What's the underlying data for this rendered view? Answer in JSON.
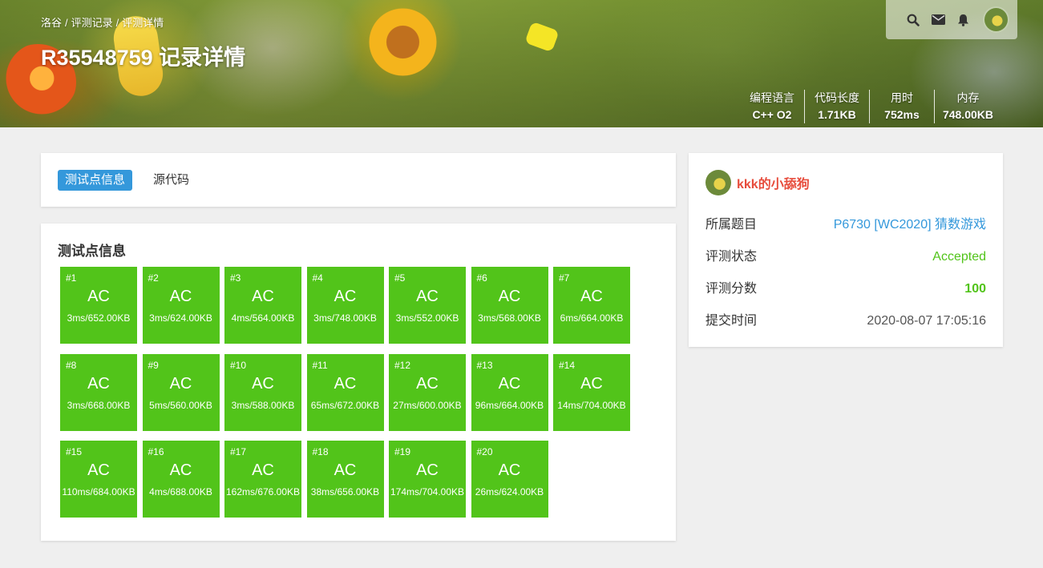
{
  "breadcrumb": {
    "items": [
      "洛谷",
      "评测记录",
      "评测详情"
    ]
  },
  "page": {
    "title": "R35548759 记录详情"
  },
  "stats": [
    {
      "label": "编程语言",
      "value": "C++ O2"
    },
    {
      "label": "代码长度",
      "value": "1.71KB"
    },
    {
      "label": "用时",
      "value": "752ms"
    },
    {
      "label": "内存",
      "value": "748.00KB"
    }
  ],
  "tabs": {
    "testcases_label": "测试点信息",
    "source_label": "源代码"
  },
  "tests_section": {
    "heading": "测试点信息",
    "status_color": "#52c41a",
    "items": [
      {
        "id": "#1",
        "status": "AC",
        "detail": "3ms/652.00KB"
      },
      {
        "id": "#2",
        "status": "AC",
        "detail": "3ms/624.00KB"
      },
      {
        "id": "#3",
        "status": "AC",
        "detail": "4ms/564.00KB"
      },
      {
        "id": "#4",
        "status": "AC",
        "detail": "3ms/748.00KB"
      },
      {
        "id": "#5",
        "status": "AC",
        "detail": "3ms/552.00KB"
      },
      {
        "id": "#6",
        "status": "AC",
        "detail": "3ms/568.00KB"
      },
      {
        "id": "#7",
        "status": "AC",
        "detail": "6ms/664.00KB"
      },
      {
        "id": "#8",
        "status": "AC",
        "detail": "3ms/668.00KB"
      },
      {
        "id": "#9",
        "status": "AC",
        "detail": "5ms/560.00KB"
      },
      {
        "id": "#10",
        "status": "AC",
        "detail": "3ms/588.00KB"
      },
      {
        "id": "#11",
        "status": "AC",
        "detail": "65ms/672.00KB"
      },
      {
        "id": "#12",
        "status": "AC",
        "detail": "27ms/600.00KB"
      },
      {
        "id": "#13",
        "status": "AC",
        "detail": "96ms/664.00KB"
      },
      {
        "id": "#14",
        "status": "AC",
        "detail": "14ms/704.00KB"
      },
      {
        "id": "#15",
        "status": "AC",
        "detail": "110ms/684.00KB"
      },
      {
        "id": "#16",
        "status": "AC",
        "detail": "4ms/688.00KB"
      },
      {
        "id": "#17",
        "status": "AC",
        "detail": "162ms/676.00KB"
      },
      {
        "id": "#18",
        "status": "AC",
        "detail": "38ms/656.00KB"
      },
      {
        "id": "#19",
        "status": "AC",
        "detail": "174ms/704.00KB"
      },
      {
        "id": "#20",
        "status": "AC",
        "detail": "26ms/624.00KB"
      }
    ]
  },
  "info": {
    "username": "kkk的小舔狗",
    "username_color": "#e74c3c",
    "problem_label": "所属题目",
    "problem_value": "P6730 [WC2020] 猜数游戏",
    "status_label": "评测状态",
    "status_value": "Accepted",
    "score_label": "评测分数",
    "score_value": "100",
    "time_label": "提交时间",
    "time_value": "2020-08-07 17:05:16"
  },
  "icons": {
    "topbar": [
      "search-icon",
      "mail-icon",
      "bell-icon"
    ]
  },
  "colors": {
    "accent": "#3498db",
    "accepted": "#52c41a"
  }
}
